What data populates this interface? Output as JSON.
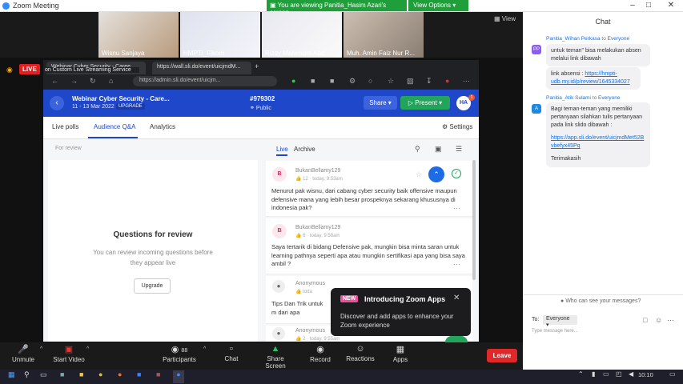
{
  "window": {
    "title": "Zoom Meeting",
    "viewing_banner": "You are viewing Panitia_Hasim Azari's screen",
    "view_options": "View Options",
    "view_label": "View"
  },
  "thumbnails": [
    {
      "name": "Wisnu Sanjaya"
    },
    {
      "name": "HMPTI_Fikom"
    },
    {
      "name": "Rizqy Mahendra Abd..."
    },
    {
      "name": "Muh. Amin Faiz Nur R..."
    }
  ],
  "live_label": "LIVE",
  "browser": {
    "tab1": "Webinar Cyber Security - Caree...",
    "tab2": "https://wall.sli.do/event/uicjmdM...",
    "custom_stream": "on Custom Live Streaming Service",
    "url": "https://admin.sli.do/event/uicjm..."
  },
  "slido": {
    "event_title": "Webinar Cyber Security - Care...",
    "event_date": "11 - 13 Mar 2022",
    "upgrade_tag": "UPGRADE",
    "code": "#979302",
    "public": "Public",
    "share": "Share",
    "present": "Present",
    "avatar": "HA",
    "badge": "1",
    "tabs": [
      "Live polls",
      "Audience Q&A",
      "Analytics"
    ],
    "settings": "Settings",
    "for_review": "For review",
    "live": "Live",
    "archive": "Archive",
    "review_title": "Questions for review",
    "review_desc": "You can review incoming questions before they appear live",
    "upgrade_btn": "Upgrade",
    "questions": [
      {
        "initial": "B",
        "author": "BukanBellamy129",
        "likes": "12",
        "time": "today, 9:53am",
        "text": "Menurut pak wisnu, dari cabang cyber security baik offensive maupun defensive mana yang lebih besar prospeknya sekarang khususnya di indonesia pak?"
      },
      {
        "initial": "B",
        "author": "BukanBellamy129",
        "likes": "6",
        "time": "today, 9:58am",
        "text": "Saya tertarik di bidang Defensive pak, mungkin bisa minta saran untuk learning pathnya seperti apa atau mungkin sertifikasi apa yang bisa saya ambil ?"
      },
      {
        "initial": "",
        "author": "Anonymous",
        "likes": "",
        "time": "toda",
        "text": "Tips Dan Trik untuk m dari apa"
      },
      {
        "initial": "",
        "author": "Anonymous",
        "likes": "2",
        "time": "today, 9:55am",
        "text": ""
      }
    ]
  },
  "popup": {
    "tag": "NEW",
    "title": "Introducing Zoom Apps",
    "desc": "Discover and add apps to enhance your Zoom experience"
  },
  "toolbar": {
    "unmute": "Unmute",
    "start_video": "Start Video",
    "participants": "Participants",
    "participants_count": "88",
    "chat": "Chat",
    "share_screen": "Share Screen",
    "record": "Record",
    "reactions": "Reactions",
    "apps": "Apps",
    "leave": "Leave"
  },
  "chat": {
    "header": "Chat",
    "messages": [
      {
        "initials": "PP",
        "sender": "Panitia_Wihan Perkasa",
        "to": "to",
        "recipient": "Everyone"
      },
      {
        "initials": "A",
        "sender": "Panitia_Atik Sulami",
        "to": "to",
        "recipient": "Everyone"
      }
    ],
    "m1": "untuk teman\" bisa melakukan absen melalui link dibawah",
    "m2_prefix": "link absensi : ",
    "m2_link": "https://hmpti-udb.my.id/p/review/1645334027",
    "m3": "Bagi teman-teman yang memiliki pertanyaan silahkan tulis pertanyaan pada link slido dibawah :",
    "m3_link": "https://app.sli.do/event/uicjmdMet52Bvbefyx45Pq",
    "m3_end": "Terimakasih",
    "who_can_see": "Who can see your messages?",
    "to_label": "To:",
    "to_value": "Everyone",
    "placeholder": "Type message here..."
  },
  "taskbar": {
    "time": "10:10"
  }
}
